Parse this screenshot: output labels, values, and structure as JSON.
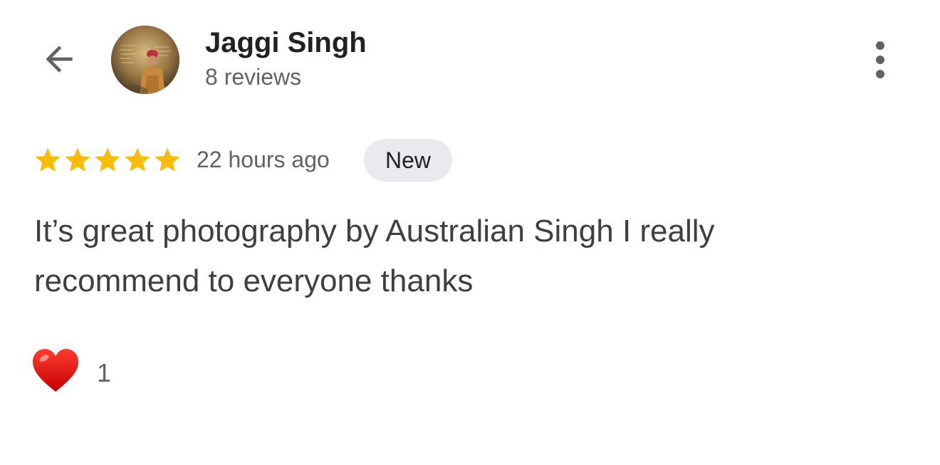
{
  "header": {
    "back_icon": "arrow-back-icon",
    "author": {
      "name": "Jaggi Singh",
      "review_count": "8 reviews",
      "avatar_icon": "profile-photo"
    },
    "more_icon": "more-vert-icon"
  },
  "review": {
    "rating": 5,
    "rating_max": 5,
    "star_color": "#FBBC04",
    "time_ago": "22 hours ago",
    "badge": "New",
    "text": "It’s great photography by Australian Singh I really recommend to everyone thanks"
  },
  "reactions": {
    "icon": "red-heart-icon",
    "count": "1"
  }
}
